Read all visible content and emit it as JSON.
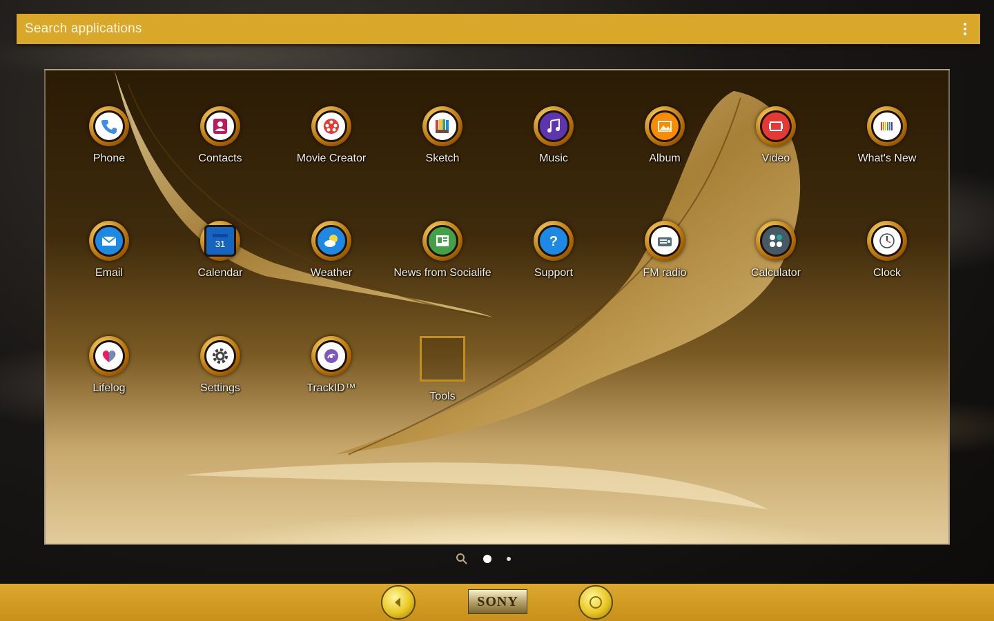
{
  "search": {
    "placeholder": "Search applications"
  },
  "apps": [
    {
      "label": "Phone",
      "icon": "phone-icon",
      "color": "#3a8ee6"
    },
    {
      "label": "Contacts",
      "icon": "contacts-icon",
      "color": "#c2185b"
    },
    {
      "label": "Movie Creator",
      "icon": "movie-creator-icon",
      "color": "#e53935"
    },
    {
      "label": "Sketch",
      "icon": "sketch-icon",
      "color": "#43a047"
    },
    {
      "label": "Music",
      "icon": "music-icon",
      "color": "#5e35b1"
    },
    {
      "label": "Album",
      "icon": "album-icon",
      "color": "#fb8c00"
    },
    {
      "label": "Video",
      "icon": "video-icon",
      "color": "#e53935"
    },
    {
      "label": "What's New",
      "icon": "whats-new-icon",
      "color": "#8e24aa"
    },
    {
      "label": "Email",
      "icon": "email-icon",
      "color": "#1e88e5"
    },
    {
      "label": "Calendar",
      "icon": "calendar-icon",
      "color": "#1565c0"
    },
    {
      "label": "Weather",
      "icon": "weather-icon",
      "color": "#1e88e5"
    },
    {
      "label": "News from Socialife",
      "icon": "socialife-icon",
      "color": "#43a047"
    },
    {
      "label": "Support",
      "icon": "support-icon",
      "color": "#1e88e5"
    },
    {
      "label": "FM radio",
      "icon": "fm-radio-icon",
      "color": "#546e7a"
    },
    {
      "label": "Calculator",
      "icon": "calculator-icon",
      "color": "#455a64"
    },
    {
      "label": "Clock",
      "icon": "clock-icon",
      "color": "#37474f"
    },
    {
      "label": "Lifelog",
      "icon": "lifelog-icon",
      "color": "#e91e63"
    },
    {
      "label": "Settings",
      "icon": "settings-icon",
      "color": "#424242"
    },
    {
      "label": "TrackID™",
      "icon": "trackid-icon",
      "color": "#7e57c2"
    },
    {
      "label": "Tools",
      "icon": "tools-folder-icon",
      "color": "#c18f1e"
    }
  ],
  "calendar_day": "31",
  "page_indicator": {
    "pages": 2,
    "current": 1
  },
  "dock": {
    "brand": "SONY",
    "left_button": "back-button",
    "right_button": "home-button"
  },
  "colors": {
    "accent": "#d9a82a",
    "ring": "#b06a00"
  }
}
